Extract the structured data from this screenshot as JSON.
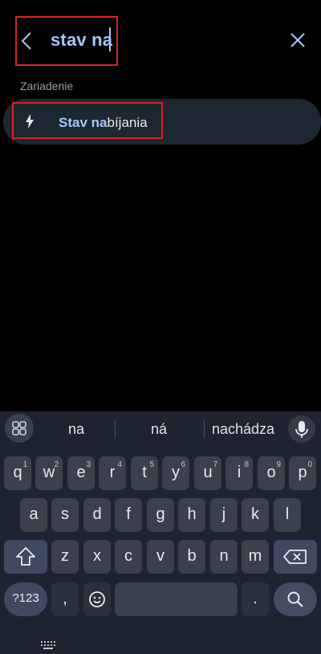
{
  "search": {
    "query": "stav na",
    "back_icon": "back-arrow-icon",
    "clear_icon": "close-icon",
    "highlight_color": "#d32424"
  },
  "results": {
    "section_label": "Zariadenie",
    "items": [
      {
        "icon": "lightning-bolt-icon",
        "match": "Stav na",
        "rest": "bíjania"
      }
    ]
  },
  "keyboard": {
    "suggestions": [
      "na",
      "ná",
      "nachádza"
    ],
    "row1": [
      {
        "k": "q",
        "s": "1"
      },
      {
        "k": "w",
        "s": "2"
      },
      {
        "k": "e",
        "s": "3"
      },
      {
        "k": "r",
        "s": "4"
      },
      {
        "k": "t",
        "s": "5"
      },
      {
        "k": "y",
        "s": "6"
      },
      {
        "k": "u",
        "s": "7"
      },
      {
        "k": "i",
        "s": "8"
      },
      {
        "k": "o",
        "s": "9"
      },
      {
        "k": "p",
        "s": "0"
      }
    ],
    "row2": [
      "a",
      "s",
      "d",
      "f",
      "g",
      "h",
      "j",
      "k",
      "l"
    ],
    "row3": [
      "z",
      "x",
      "c",
      "v",
      "b",
      "n",
      "m"
    ],
    "symbols_label": "?123",
    "comma_label": ",",
    "period_label": ".",
    "accent_color": "#a8c7fa"
  }
}
